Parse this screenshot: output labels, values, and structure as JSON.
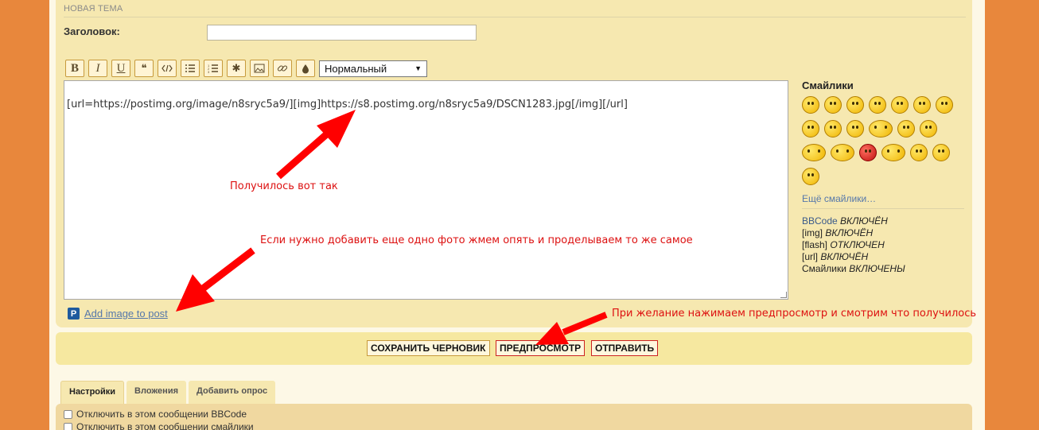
{
  "form": {
    "section_title": "НОВАЯ ТЕМА",
    "subject_label": "Заголовок:",
    "subject_value": ""
  },
  "toolbar": {
    "bold": "B",
    "italic": "I",
    "underline": "U",
    "font_size_select": "Нормальный"
  },
  "editor": {
    "content": "[url=https://postimg.org/image/n8sryc5a9/][img]https://s8.postimg.org/n8sryc5a9/DSCN1283.jpg[/img][/url]"
  },
  "annotations": {
    "note_1": "Получилось вот так",
    "note_2": "Если нужно добавить еще одно фото жмем опять и проделываем то же самое",
    "note_3": "При желание нажимаем предпросмотр и смотрим что получилось"
  },
  "add_image": {
    "icon": "P",
    "link": "Add image to post"
  },
  "smilies": {
    "title": "Смайлики",
    "more": "Ещё смайлики…"
  },
  "codes": {
    "bbcode_label": "BBCode",
    "bbcode_state": "ВКЛЮЧЁН",
    "img_label": "[img]",
    "img_state": "ВКЛЮЧЁН",
    "flash_label": "[flash]",
    "flash_state": "ОТКЛЮЧЕН",
    "url_label": "[url]",
    "url_state": "ВКЛЮЧЁН",
    "smilies_label": "Смайлики",
    "smilies_state": "ВКЛЮЧЕНЫ"
  },
  "actions": {
    "save_draft": "СОХРАНИТЬ ЧЕРНОВИК",
    "preview": "ПРЕДПРОСМОТР",
    "submit": "ОТПРАВИТЬ"
  },
  "tabs": [
    "Настройки",
    "Вложения",
    "Добавить опрос"
  ],
  "options": {
    "opt_1": "Отключить в этом сообщении BBCode",
    "opt_2": "Отключить в этом сообщении смайлики"
  },
  "colors": {
    "background": "#e8873c",
    "panel": "#f6e8b0",
    "annotation": "#dd1111",
    "arrow": "#ff0000"
  }
}
